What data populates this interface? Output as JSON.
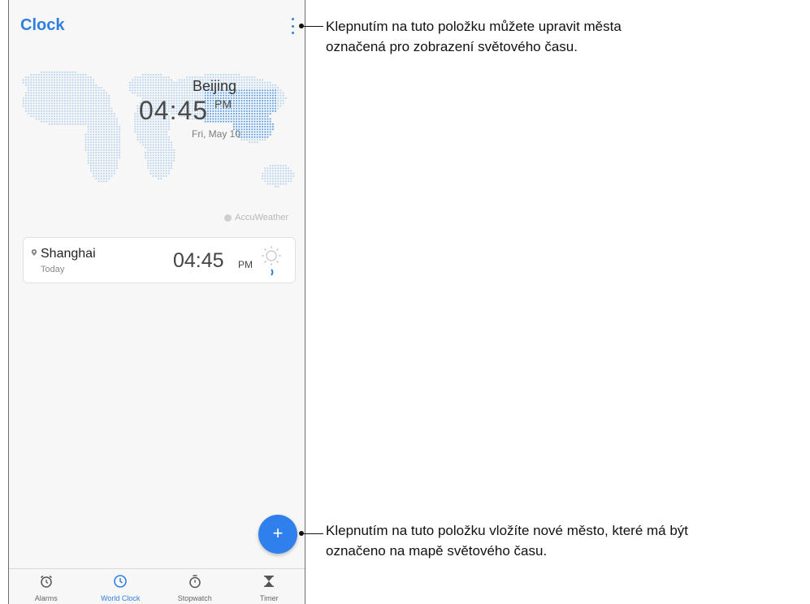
{
  "app": {
    "title": "Clock"
  },
  "world_clock": {
    "featured_city": "Beijing",
    "featured_time": "04:45",
    "featured_ampm": "PM",
    "featured_date": "Fri, May 10",
    "weather_provider": "AccuWeather"
  },
  "cities": [
    {
      "name": "Shanghai",
      "day": "Today",
      "time": "04:45",
      "ampm": "PM",
      "weather_icon": "sun-icon"
    }
  ],
  "fab": {
    "label": "+"
  },
  "bottom_nav": [
    {
      "label": "Alarms",
      "icon": "alarm-icon"
    },
    {
      "label": "World Clock",
      "icon": "clock-icon",
      "active": true
    },
    {
      "label": "Stopwatch",
      "icon": "stopwatch-icon"
    },
    {
      "label": "Timer",
      "icon": "hourglass-icon"
    }
  ],
  "callouts": {
    "menu": "Klepnutím na tuto položku můžete upravit města označená pro zobrazení světového času.",
    "menu_line1": "Klepnutím na tuto položku můžete upravit města",
    "menu_line2": "označená pro zobrazení světového času.",
    "add_line1": "Klepnutím na tuto položku vložíte nové město, které má být",
    "add_line2": "označeno na mapě světového času."
  },
  "colors": {
    "accent": "#2f7fe0",
    "fab": "#2f80ed"
  }
}
